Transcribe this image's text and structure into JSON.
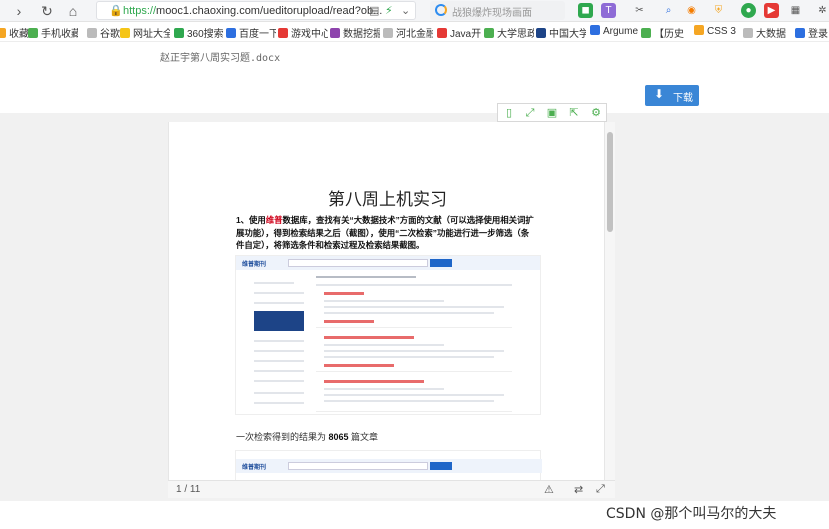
{
  "browser": {
    "nav": {
      "forward": "›",
      "reload": "↻",
      "home": "⌂"
    },
    "url_proto": "https://",
    "url_rest": "mooc1.chaoxing.com/ueditorupload/read?ob...",
    "search_placeholder": "战狼爆炸现场画面"
  },
  "bookmarks": [
    {
      "label": "收藏",
      "color": "#f5a623"
    },
    {
      "label": "手机收藏夹",
      "color": "#4caf50"
    },
    {
      "label": "谷歌",
      "color": "#bbbbbb"
    },
    {
      "label": "网址大全",
      "color": "#f5c518"
    },
    {
      "label": "360搜索",
      "color": "#2fa84f"
    },
    {
      "label": "百度一下",
      "color": "#2d6fe0"
    },
    {
      "label": "游戏中心",
      "color": "#e53935"
    },
    {
      "label": "数据挖掘",
      "color": "#8e44ad"
    },
    {
      "label": "河北金融",
      "color": "#bbbbbb"
    },
    {
      "label": "Java开",
      "color": "#e53935"
    },
    {
      "label": "大学思政",
      "color": "#4caf50"
    },
    {
      "label": "中国大学",
      "color": "#1d4487"
    },
    {
      "label": "Argume",
      "color": "#2d6fe0"
    },
    {
      "label": "【历史",
      "color": "#4caf50"
    },
    {
      "label": "CSS 3",
      "color": "#f5a623"
    },
    {
      "label": "大数据",
      "color": "#bbbbbb"
    },
    {
      "label": "登录",
      "color": "#2d6fe0"
    }
  ],
  "doc": {
    "filename": "赵正宇第八周实习题.docx",
    "download_label": "下载",
    "title": "第八周上机实习",
    "q_num": "1",
    "q_pre": "、使用",
    "q_red": "维普",
    "q_post": "数据库，查找有关“大数据技术”方面的文献（可以选择使用相关词扩展功能），得到检索结果之后（截图），使用“二次检索”功能进行进一步筛选（条件自定），将筛选条件和检索过程及检索结果截图。",
    "caption_pre": "一次检索得到的结果为 ",
    "caption_num": "8065",
    "caption_post": " 篇文章",
    "shot_logo": "维普期刊"
  },
  "viewer": {
    "page_indicator": "1 / 11",
    "tool_color": "#4caf50"
  },
  "watermark": "CSDN @那个叫马尔的大夫"
}
